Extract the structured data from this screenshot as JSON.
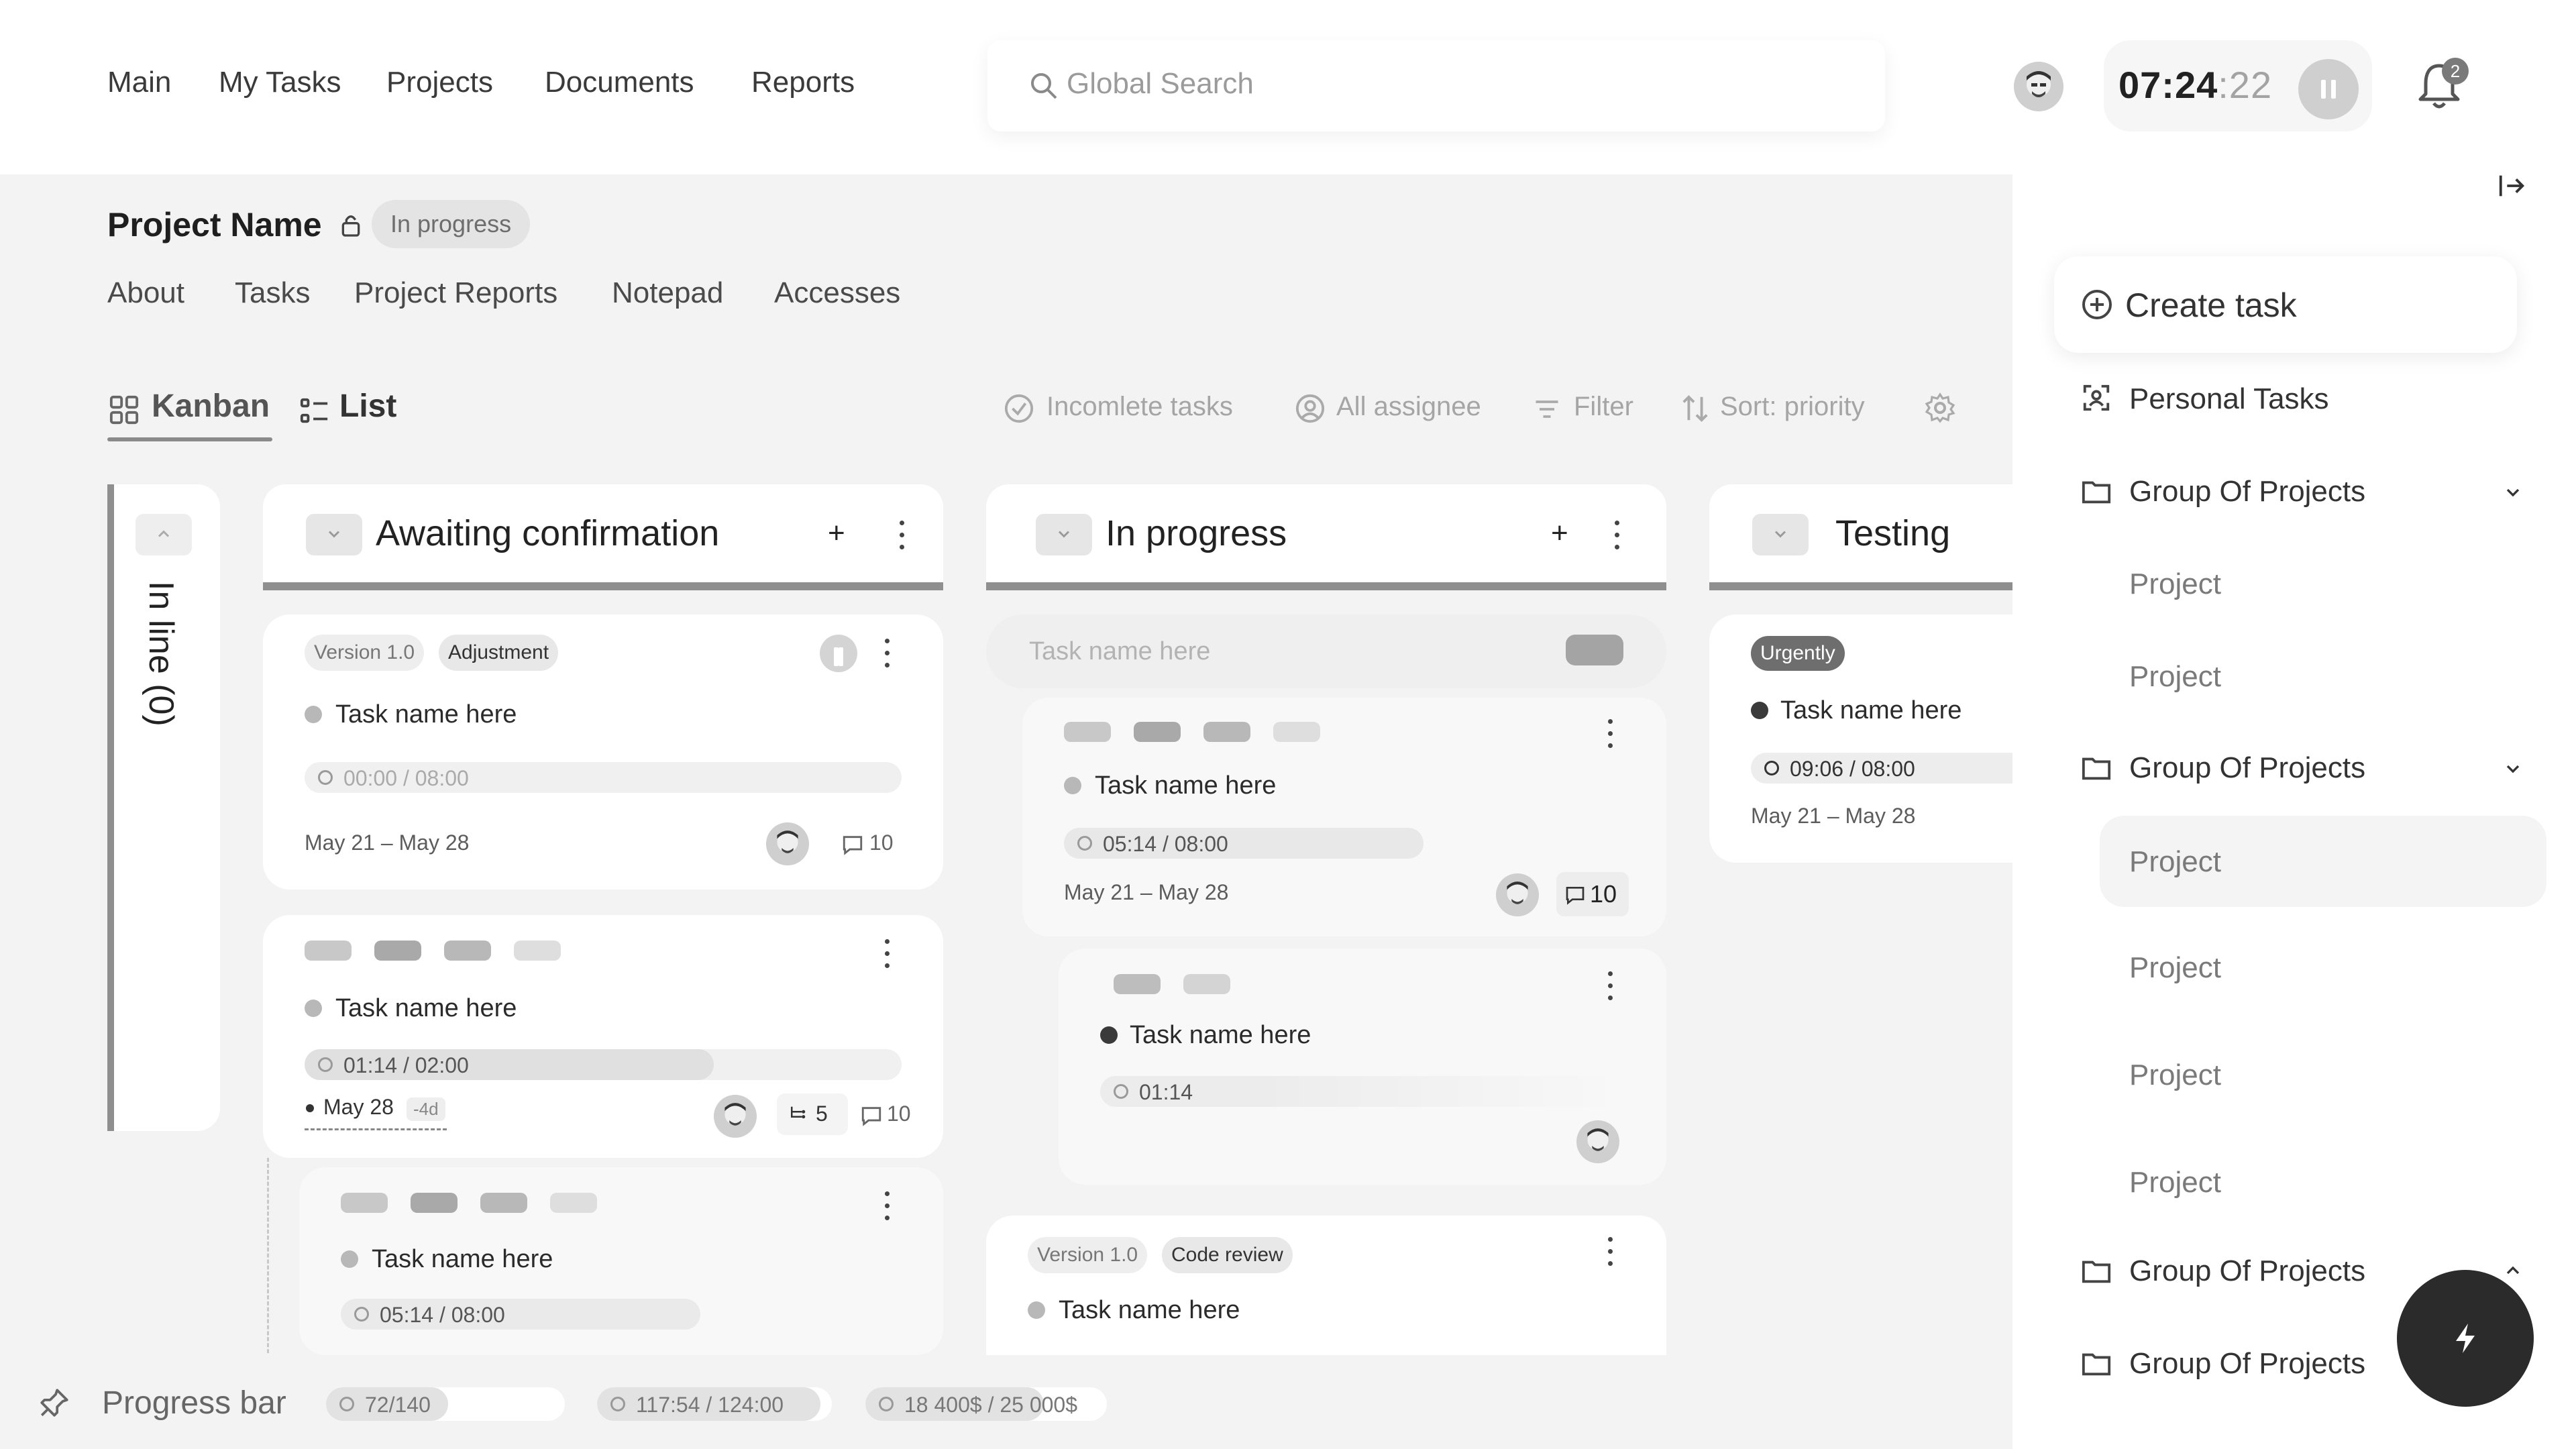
{
  "header": {
    "nav": [
      "Main",
      "My Tasks",
      "Projects",
      "Documents",
      "Reports"
    ],
    "search_placeholder": "Global Search",
    "timer_main": "07:24",
    "timer_sec": ":22",
    "notifications": "2"
  },
  "project": {
    "name": "Project Name",
    "status": "In progress",
    "tabs": [
      "About",
      "Tasks",
      "Project Reports",
      "Notepad",
      "Accesses"
    ]
  },
  "views": {
    "kanban": "Kanban",
    "list": "List"
  },
  "toolbar": {
    "incomplete": "Incomlete tasks",
    "assignee": "All assignee",
    "filter": "Filter",
    "sort": "Sort: priority"
  },
  "columns": {
    "inline": "In line (0)",
    "awaiting": "Awaiting confirmation",
    "inprogress": "In progress",
    "testing": "Testing",
    "add": "+"
  },
  "cards": {
    "a1": {
      "tag1": "Version 1.0",
      "tag2": "Adjustment",
      "name": "Task name here",
      "time": "00:00 / 08:00",
      "date": "May 21 – May 28",
      "comments": "10"
    },
    "a2": {
      "name": "Task name here",
      "time": "01:14 / 02:00",
      "date": "May 28",
      "overdue": "-4d",
      "subtasks": "5",
      "comments": "10"
    },
    "a3": {
      "name": "Task name here",
      "time": "05:14 / 08:00"
    },
    "p0": {
      "placeholder": "Task name here"
    },
    "p1": {
      "name": "Task name here",
      "time": "05:14 / 08:00",
      "date": "May 21 – May 28",
      "comments": "10"
    },
    "p2": {
      "name": "Task name here",
      "time": "01:14"
    },
    "p3": {
      "tag1": "Version 1.0",
      "tag2": "Code review",
      "name": "Task name here"
    },
    "t1": {
      "tag": "Urgently",
      "name": "Task name here",
      "time": "09:06 / 08:00",
      "date": "May 21 – May 28"
    }
  },
  "sidebar": {
    "create": "Create task",
    "personal": "Personal Tasks",
    "group": "Group Of Projects",
    "project": "Project"
  },
  "bottom": {
    "label": "Progress bar",
    "tasks": "72/140",
    "tasks_progress": 0.51,
    "hours": "117:54 / 124:00",
    "hours_progress": 0.95,
    "budget": "18 400$ / 25 000$",
    "budget_progress": 0.74
  }
}
